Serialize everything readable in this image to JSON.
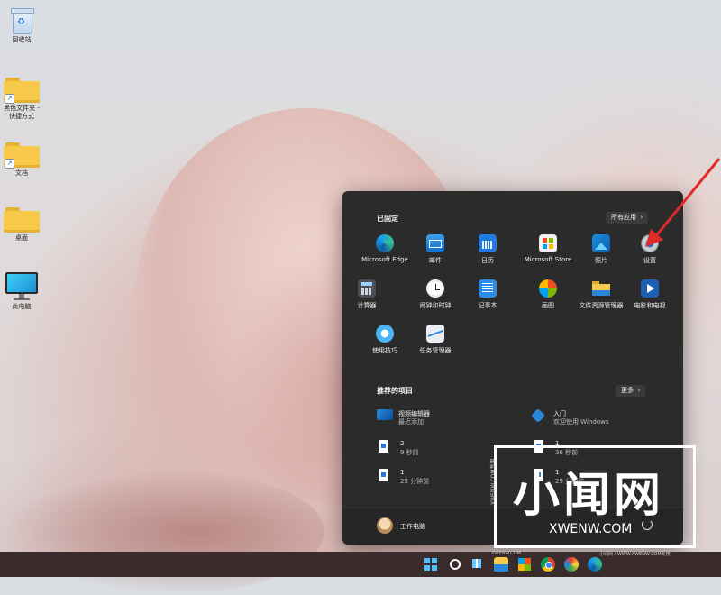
{
  "desktop": {
    "icons": [
      {
        "label": "回收站"
      },
      {
        "label": "黑色文件夹 -\n快捷方式"
      },
      {
        "label": "文档"
      },
      {
        "label": "桌面"
      },
      {
        "label": "此电脑"
      }
    ]
  },
  "start_menu": {
    "pinned_title": "已固定",
    "all_apps_label": "所有应用",
    "pinned_apps": [
      {
        "label": "Microsoft Edge",
        "icon": "edge-icon"
      },
      {
        "label": "邮件",
        "icon": "mail-icon"
      },
      {
        "label": "日历",
        "icon": "calendar-icon"
      },
      {
        "label": "Microsoft Store",
        "icon": "store-icon"
      },
      {
        "label": "照片",
        "icon": "photos-icon"
      },
      {
        "label": "设置",
        "icon": "settings-icon"
      },
      {
        "label": "计算器",
        "icon": "calculator-icon"
      },
      {
        "label": "闹钟和时钟",
        "icon": "alarm-clock-icon"
      },
      {
        "label": "记事本",
        "icon": "notepad-icon"
      },
      {
        "label": "画图",
        "icon": "paint-icon"
      },
      {
        "label": "文件资源管理器",
        "icon": "file-explorer-icon"
      },
      {
        "label": "电影和电视",
        "icon": "movies-tv-icon"
      },
      {
        "label": "使用技巧",
        "icon": "tips-icon"
      },
      {
        "label": "任务管理器",
        "icon": "task-manager-icon"
      }
    ],
    "recommended_title": "推荐的项目",
    "more_label": "更多",
    "recommended": [
      {
        "title": "视频编辑器",
        "subtitle": "最近添加"
      },
      {
        "title": "入门",
        "subtitle": "欢迎使用 Windows"
      },
      {
        "title": "2",
        "subtitle": "9 秒前"
      },
      {
        "title": "1",
        "subtitle": "36 秒前"
      },
      {
        "title": "1",
        "subtitle": "29 分钟前"
      },
      {
        "title": "1",
        "subtitle": "29 分钟前"
      }
    ],
    "user_name": "工作电脑"
  },
  "watermark": {
    "big": "小闻网",
    "url": "XWENW.COM",
    "side": "XWENW.COM专用",
    "small1": "XWENW.COM",
    "small2": "小闻网 / WWW.XWENW.COM专用"
  },
  "colors": {
    "start_bg": "#2b2b2c",
    "taskbar_bg": "#3a2b2d",
    "accent_arrow": "#e02a2a"
  }
}
